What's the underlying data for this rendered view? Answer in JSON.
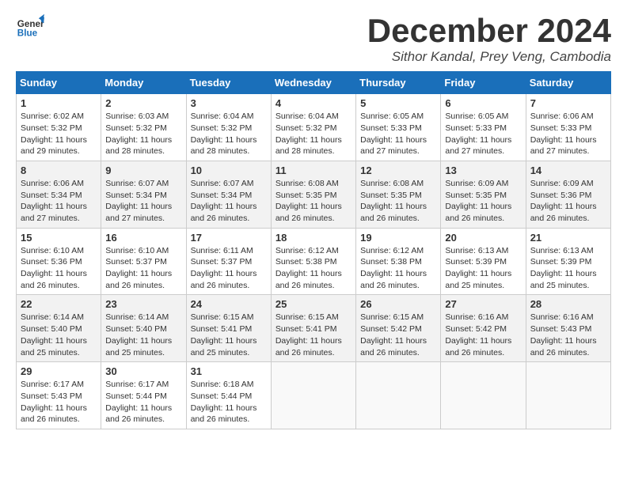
{
  "header": {
    "logo_general": "General",
    "logo_blue": "Blue",
    "title": "December 2024",
    "subtitle": "Sithor Kandal, Prey Veng, Cambodia"
  },
  "days_of_week": [
    "Sunday",
    "Monday",
    "Tuesday",
    "Wednesday",
    "Thursday",
    "Friday",
    "Saturday"
  ],
  "weeks": [
    [
      {
        "day": "1",
        "sunrise": "6:02 AM",
        "sunset": "5:32 PM",
        "daylight": "11 hours and 29 minutes."
      },
      {
        "day": "2",
        "sunrise": "6:03 AM",
        "sunset": "5:32 PM",
        "daylight": "11 hours and 28 minutes."
      },
      {
        "day": "3",
        "sunrise": "6:04 AM",
        "sunset": "5:32 PM",
        "daylight": "11 hours and 28 minutes."
      },
      {
        "day": "4",
        "sunrise": "6:04 AM",
        "sunset": "5:32 PM",
        "daylight": "11 hours and 28 minutes."
      },
      {
        "day": "5",
        "sunrise": "6:05 AM",
        "sunset": "5:33 PM",
        "daylight": "11 hours and 27 minutes."
      },
      {
        "day": "6",
        "sunrise": "6:05 AM",
        "sunset": "5:33 PM",
        "daylight": "11 hours and 27 minutes."
      },
      {
        "day": "7",
        "sunrise": "6:06 AM",
        "sunset": "5:33 PM",
        "daylight": "11 hours and 27 minutes."
      }
    ],
    [
      {
        "day": "8",
        "sunrise": "6:06 AM",
        "sunset": "5:34 PM",
        "daylight": "11 hours and 27 minutes."
      },
      {
        "day": "9",
        "sunrise": "6:07 AM",
        "sunset": "5:34 PM",
        "daylight": "11 hours and 27 minutes."
      },
      {
        "day": "10",
        "sunrise": "6:07 AM",
        "sunset": "5:34 PM",
        "daylight": "11 hours and 26 minutes."
      },
      {
        "day": "11",
        "sunrise": "6:08 AM",
        "sunset": "5:35 PM",
        "daylight": "11 hours and 26 minutes."
      },
      {
        "day": "12",
        "sunrise": "6:08 AM",
        "sunset": "5:35 PM",
        "daylight": "11 hours and 26 minutes."
      },
      {
        "day": "13",
        "sunrise": "6:09 AM",
        "sunset": "5:35 PM",
        "daylight": "11 hours and 26 minutes."
      },
      {
        "day": "14",
        "sunrise": "6:09 AM",
        "sunset": "5:36 PM",
        "daylight": "11 hours and 26 minutes."
      }
    ],
    [
      {
        "day": "15",
        "sunrise": "6:10 AM",
        "sunset": "5:36 PM",
        "daylight": "11 hours and 26 minutes."
      },
      {
        "day": "16",
        "sunrise": "6:10 AM",
        "sunset": "5:37 PM",
        "daylight": "11 hours and 26 minutes."
      },
      {
        "day": "17",
        "sunrise": "6:11 AM",
        "sunset": "5:37 PM",
        "daylight": "11 hours and 26 minutes."
      },
      {
        "day": "18",
        "sunrise": "6:12 AM",
        "sunset": "5:38 PM",
        "daylight": "11 hours and 26 minutes."
      },
      {
        "day": "19",
        "sunrise": "6:12 AM",
        "sunset": "5:38 PM",
        "daylight": "11 hours and 26 minutes."
      },
      {
        "day": "20",
        "sunrise": "6:13 AM",
        "sunset": "5:39 PM",
        "daylight": "11 hours and 25 minutes."
      },
      {
        "day": "21",
        "sunrise": "6:13 AM",
        "sunset": "5:39 PM",
        "daylight": "11 hours and 25 minutes."
      }
    ],
    [
      {
        "day": "22",
        "sunrise": "6:14 AM",
        "sunset": "5:40 PM",
        "daylight": "11 hours and 25 minutes."
      },
      {
        "day": "23",
        "sunrise": "6:14 AM",
        "sunset": "5:40 PM",
        "daylight": "11 hours and 25 minutes."
      },
      {
        "day": "24",
        "sunrise": "6:15 AM",
        "sunset": "5:41 PM",
        "daylight": "11 hours and 25 minutes."
      },
      {
        "day": "25",
        "sunrise": "6:15 AM",
        "sunset": "5:41 PM",
        "daylight": "11 hours and 26 minutes."
      },
      {
        "day": "26",
        "sunrise": "6:15 AM",
        "sunset": "5:42 PM",
        "daylight": "11 hours and 26 minutes."
      },
      {
        "day": "27",
        "sunrise": "6:16 AM",
        "sunset": "5:42 PM",
        "daylight": "11 hours and 26 minutes."
      },
      {
        "day": "28",
        "sunrise": "6:16 AM",
        "sunset": "5:43 PM",
        "daylight": "11 hours and 26 minutes."
      }
    ],
    [
      {
        "day": "29",
        "sunrise": "6:17 AM",
        "sunset": "5:43 PM",
        "daylight": "11 hours and 26 minutes."
      },
      {
        "day": "30",
        "sunrise": "6:17 AM",
        "sunset": "5:44 PM",
        "daylight": "11 hours and 26 minutes."
      },
      {
        "day": "31",
        "sunrise": "6:18 AM",
        "sunset": "5:44 PM",
        "daylight": "11 hours and 26 minutes."
      },
      null,
      null,
      null,
      null
    ]
  ]
}
